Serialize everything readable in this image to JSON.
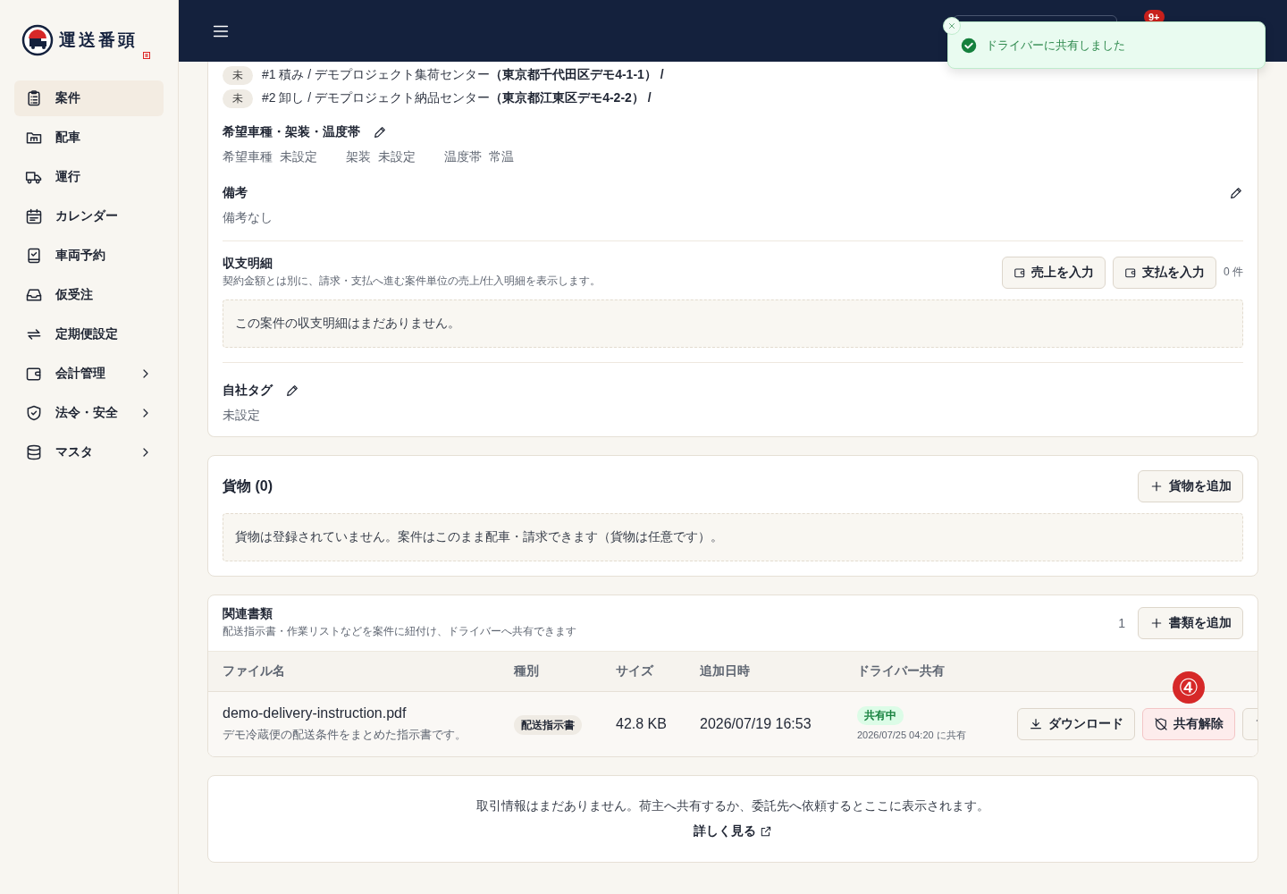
{
  "logo": {
    "text": "運送番頭"
  },
  "sidebar": {
    "items": [
      {
        "label": "案件",
        "selected": true,
        "expandable": false
      },
      {
        "label": "配車",
        "selected": false,
        "expandable": false
      },
      {
        "label": "運行",
        "selected": false,
        "expandable": false
      },
      {
        "label": "カレンダー",
        "selected": false,
        "expandable": false
      },
      {
        "label": "車両予約",
        "selected": false,
        "expandable": false
      },
      {
        "label": "仮受注",
        "selected": false,
        "expandable": false
      },
      {
        "label": "定期便設定",
        "selected": false,
        "expandable": false
      },
      {
        "label": "会計管理",
        "selected": false,
        "expandable": true
      },
      {
        "label": "法令・安全",
        "selected": false,
        "expandable": true
      },
      {
        "label": "マスタ",
        "selected": false,
        "expandable": true
      }
    ]
  },
  "header": {
    "notification_badge": "9+"
  },
  "toast": {
    "message": "ドライバーに共有しました"
  },
  "stops": [
    {
      "status": "未",
      "text": "#1 積み / デモプロジェクト集荷センター**（東京都千代田区デモ4-1-1） /**"
    },
    {
      "status": "未",
      "text": "#2 卸し / デモプロジェクト納品センター**（東京都江東区デモ4-2-2） /**"
    }
  ],
  "vehicle_spec": {
    "title": "希望車種・架装・温度帯",
    "fields": [
      {
        "label": "希望車種",
        "value": "未設定"
      },
      {
        "label": "架装",
        "value": "未設定"
      },
      {
        "label": "温度帯",
        "value": "常温"
      }
    ]
  },
  "notes": {
    "title": "備考",
    "value": "備考なし"
  },
  "ledger": {
    "title": "収支明細",
    "description": "契約金額とは別に、請求・支払へ進む案件単位の売上/仕入明細を表示します。",
    "buttons": [
      "売上を入力",
      "支払を入力"
    ],
    "count": "0 件",
    "empty": "この案件の収支明細はまだありません。"
  },
  "tags": {
    "title": "自社タグ",
    "value": "未設定"
  },
  "cargo": {
    "title": "貨物 (0)",
    "add_button": "貨物を追加",
    "empty": "貨物は登録されていません。案件はこのまま配車・請求できます（貨物は任意です）。"
  },
  "documents": {
    "title": "関連書類",
    "description": "配送指示書・作業リストなどを案件に紐付け、ドライバーへ共有できます",
    "count": "1",
    "add_button": "書類を追加",
    "columns": [
      "ファイル名",
      "種別",
      "サイズ",
      "追加日時",
      "ドライバー共有"
    ],
    "rows": [
      {
        "file_name": "demo-delivery-instruction.pdf",
        "description": "デモ冷蔵便の配送条件をまとめた指示書です。",
        "type": "配送指示書",
        "size": "42.8 KB",
        "added": "2026/07/19 16:53",
        "shared": true,
        "share_status": "共有中",
        "shared_at": "2026/07/25 04:20 に共有",
        "actions": [
          {
            "kind": "download",
            "label": "ダウンロード"
          },
          {
            "kind": "unshare",
            "label": "共有解除"
          },
          {
            "kind": "more"
          }
        ]
      }
    ]
  },
  "step_marker": "④",
  "deals": {
    "message": "取引情報はまだありません。荷主へ共有するか、委託先へ依頼するとここに表示されます。",
    "link": "詳しく見る"
  }
}
